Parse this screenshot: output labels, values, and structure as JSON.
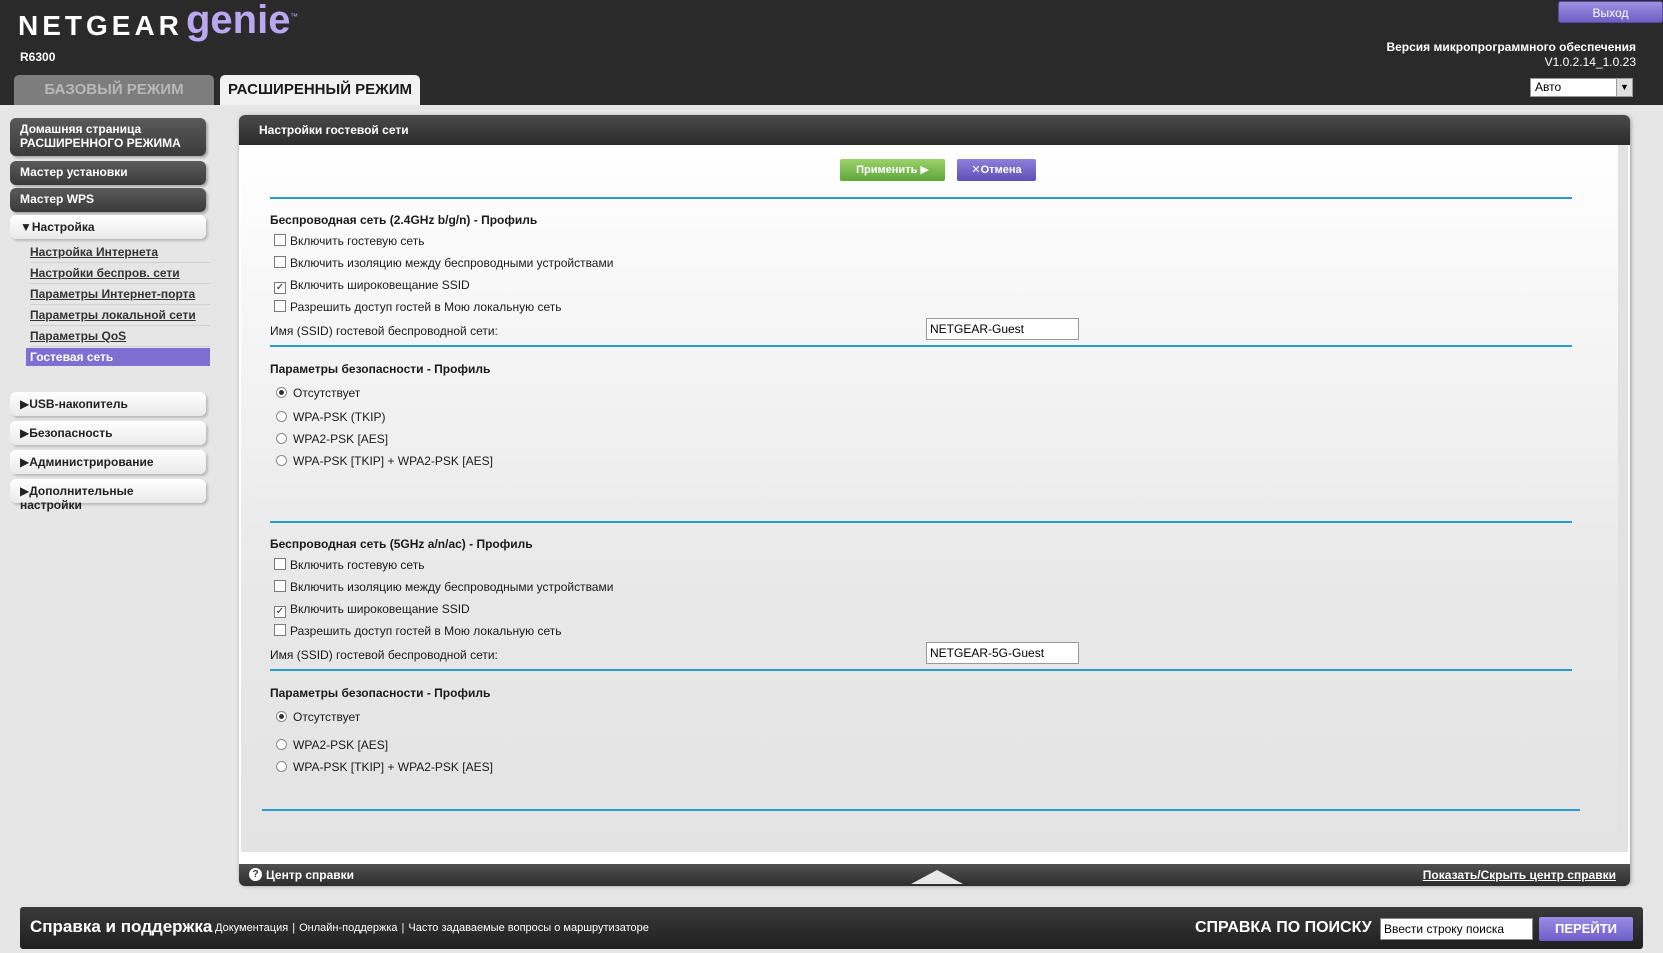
{
  "header": {
    "logo_brand": "NETGEAR",
    "logo_product": "genie",
    "logo_tm": "™",
    "model": "R6300",
    "logout_label": "Выход",
    "firmware_label": "Версия микропрограммного обеспечения",
    "firmware_version": "V1.0.2.14_1.0.23",
    "language_selected": "Авто",
    "tabs": [
      {
        "label": "БАЗОВЫЙ РЕЖИМ",
        "active": false
      },
      {
        "label": "РАСШИРЕННЫЙ РЕЖИМ",
        "active": true
      }
    ]
  },
  "sidebar": {
    "home_label": "Домашняя страница РАСШИРЕННОГО РЕЖИМА",
    "setup_wizard_label": "Мастер установки",
    "wps_wizard_label": "Мастер WPS",
    "setup_label": "Настройка",
    "setup_items": [
      "Настройка Интернета",
      "Настройки беспров. сети",
      "Параметры Интернет-порта",
      "Параметры локальной сети",
      "Параметры QoS",
      "Гостевая сеть"
    ],
    "usb_label": "USB-накопитель",
    "security_label": "Безопасность",
    "admin_label": "Администрирование",
    "advanced_label": "Дополнительные настройки"
  },
  "panel": {
    "title": "Настройки гостевой сети",
    "apply_label": "Применить ▶",
    "cancel_label": "✕Отмена",
    "band24": {
      "title": "Беспроводная сеть (2.4GHz b/g/n) - Профиль",
      "enable_guest": "Включить гостевую сеть",
      "enable_isolation": "Включить изоляцию между беспроводными устройствами",
      "enable_ssid_broadcast": "Включить широковещание SSID",
      "allow_local_access": "Разрешить доступ гостей в Мою локальную сеть",
      "ssid_label": "Имя (SSID) гостевой беспроводной сети:",
      "ssid_value": "NETGEAR-Guest",
      "security_title": "Параметры безопасности - Профиль",
      "security_options": [
        "Отсутствует",
        "WPA-PSK (TKIP)",
        "WPA2-PSK [AES]",
        "WPA-PSK [TKIP] + WPA2-PSK [AES]"
      ]
    },
    "band5": {
      "title": "Беспроводная сеть (5GHz a/n/ac) - Профиль",
      "enable_guest": "Включить гостевую сеть",
      "enable_isolation": "Включить изоляцию между беспроводными устройствами",
      "enable_ssid_broadcast": "Включить широковещание SSID",
      "allow_local_access": "Разрешить доступ гостей в Мою локальную сеть",
      "ssid_label": "Имя (SSID) гостевой беспроводной сети:",
      "ssid_value": "NETGEAR-5G-Guest",
      "security_title": "Параметры безопасности - Профиль",
      "security_options": [
        "Отсутствует",
        "WPA2-PSK [AES]",
        "WPA-PSK [TKIP] + WPA2-PSK [AES]"
      ]
    }
  },
  "helpbar": {
    "icon": "?",
    "label": "Центр справки",
    "toggle_label": "Показать/Скрыть центр справки"
  },
  "footer": {
    "title": "Справка и поддержка",
    "links": [
      "Документация",
      "Онлайн-поддержка",
      "Часто задаваемые вопросы о маршрутизаторе"
    ],
    "search_label": "СПРАВКА ПО ПОИСКУ",
    "search_placeholder": "Ввести строку поиска",
    "search_button": "ПЕРЕЙТИ"
  },
  "colors": {
    "accent_purple": "#7f6fd3",
    "apply_green": "#5fa63a",
    "separator_blue": "#2d9bc9",
    "header_bg": "#2a2a2a"
  },
  "icons": [
    "question-circle-icon",
    "triangle-down-icon",
    "triangle-right-icon",
    "checkbox-check-icon",
    "close-x-icon",
    "play-arrow-icon",
    "chevron-up-icon"
  ]
}
